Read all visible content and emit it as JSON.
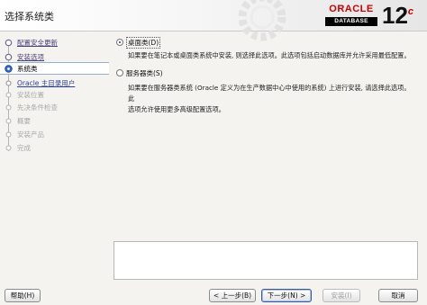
{
  "header": {
    "title": "选择系统类",
    "logo_text": "ORACLE",
    "logo_sub": "DATABASE",
    "version": "12",
    "version_suffix": "c"
  },
  "steps": [
    {
      "label": "配置安全更新",
      "state": "done"
    },
    {
      "label": "安装选项",
      "state": "done"
    },
    {
      "label": "系统类",
      "state": "current"
    },
    {
      "label": "Oracle 主目录用户",
      "state": "next"
    },
    {
      "label": "安装位置",
      "state": "future"
    },
    {
      "label": "先决条件检查",
      "state": "future"
    },
    {
      "label": "概要",
      "state": "future"
    },
    {
      "label": "安装产品",
      "state": "future"
    },
    {
      "label": "完成",
      "state": "future"
    }
  ],
  "options": {
    "desktop": {
      "label": "桌面类(D)",
      "selected": true,
      "desc_line1": "如果要在笔记本或桌面类系统中安装, 则选择此选项。此选项包括启动数据库并允许采用最低配置。"
    },
    "server": {
      "label": "服务器类(S)",
      "selected": false,
      "desc_line1": "如果要在服务器类系统 (Oracle 定义为在生产数据中心中使用的系统) 上进行安装, 请选择此选项。此",
      "desc_line2": "选项允许使用更多高级配置选项。"
    }
  },
  "buttons": {
    "help": "帮助(H)",
    "back": "< 上一步(B)",
    "next": "下一步(N) >",
    "install": "安装(I)",
    "cancel": "取消"
  },
  "colors": {
    "oracle_red": "#cc0000",
    "step_done": "#4a3f7a",
    "step_future": "#a8a8a8"
  }
}
